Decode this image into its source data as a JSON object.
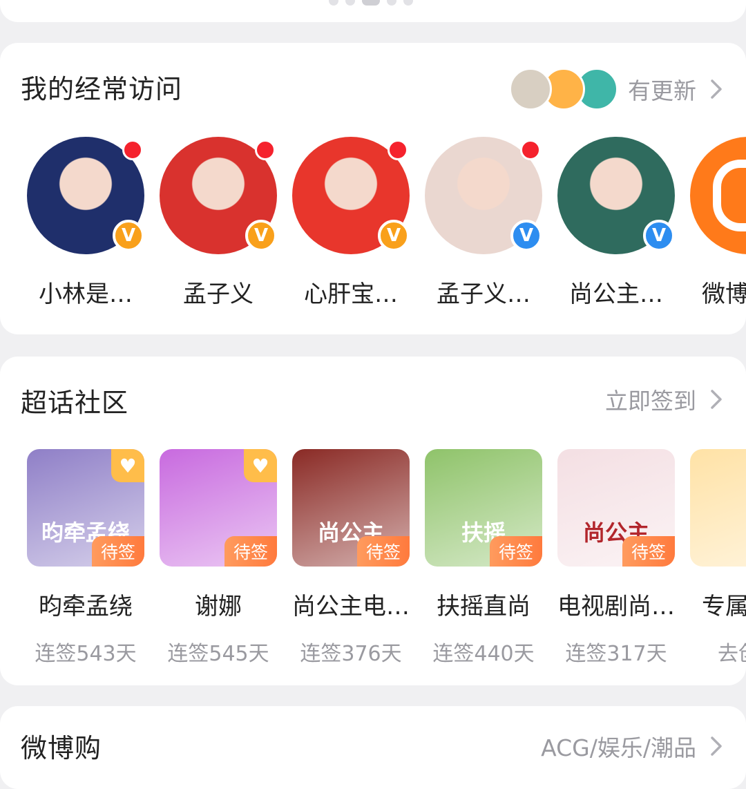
{
  "frequent": {
    "title": "我的经常访问",
    "update_label": "有更新",
    "mini_avatars": [
      "#d8cfc2",
      "#ffb347",
      "#3fb6a8"
    ],
    "items": [
      {
        "name": "小林是…",
        "verify": "gold",
        "red_dot": true,
        "bg": "#1f2f6b"
      },
      {
        "name": "孟子义",
        "verify": "gold",
        "red_dot": true,
        "bg": "#d9322e"
      },
      {
        "name": "心肝宝…",
        "verify": "gold",
        "red_dot": true,
        "bg": "#e8362c"
      },
      {
        "name": "孟子义…",
        "verify": "blue",
        "red_dot": true,
        "bg": "#ead7d0"
      },
      {
        "name": "尚公主…",
        "verify": "blue",
        "red_dot": false,
        "bg": "#2f6b5e"
      },
      {
        "name": "微博智…",
        "verify": "",
        "red_dot": false,
        "bg": "#ff7a1a"
      }
    ],
    "verify_glyph": "V"
  },
  "super_topic": {
    "title": "超话社区",
    "action_label": "立即签到",
    "pending_label": "待签",
    "items": [
      {
        "name": "昀牵孟绕",
        "streak": "连签543天",
        "bg": "#8f7fc7",
        "text": "昀牵孟绕",
        "heart": true
      },
      {
        "name": "谢娜",
        "streak": "连签545天",
        "bg": "#c86adf",
        "text": "",
        "heart": true
      },
      {
        "name": "尚公主电…",
        "streak": "连签376天",
        "bg": "#8a2a25",
        "text": "尚公主",
        "heart": false
      },
      {
        "name": "扶摇直尚",
        "streak": "连签440天",
        "bg": "#8fc36a",
        "text": "扶摇",
        "heart": false
      },
      {
        "name": "电视剧尚…",
        "streak": "连签317天",
        "bg": "#f4dfe3",
        "text": "尚公主",
        "heart": false
      },
      {
        "name": "专属超…",
        "streak": "去创…",
        "bg": "#ffe2a6",
        "text": "",
        "heart": false
      }
    ]
  },
  "shop": {
    "title": "微博购",
    "tags_label": "ACG/娱乐/潮品"
  }
}
